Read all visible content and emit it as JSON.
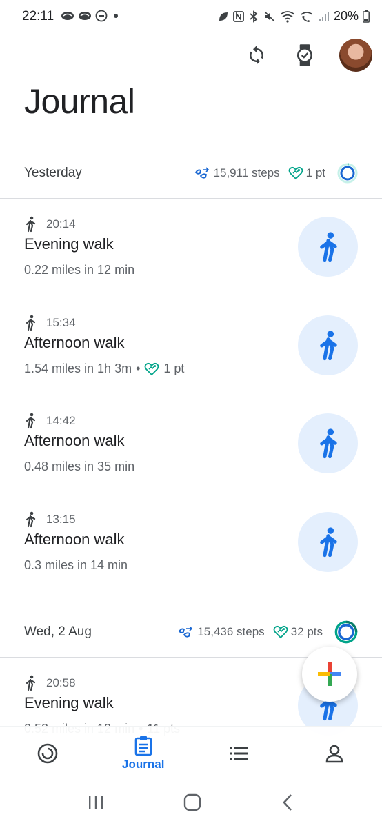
{
  "status_bar": {
    "time": "22:11",
    "battery": "20%"
  },
  "header": {
    "title": "Journal"
  },
  "days": [
    {
      "label": "Yesterday",
      "steps": "15,911 steps",
      "heart_points": "1 pt",
      "activities": [
        {
          "time": "20:14",
          "title": "Evening walk",
          "detail": "0.22 miles in 12 min",
          "points": ""
        },
        {
          "time": "15:34",
          "title": "Afternoon walk",
          "detail": "1.54 miles in 1h 3m",
          "points": "1 pt"
        },
        {
          "time": "14:42",
          "title": "Afternoon walk",
          "detail": "0.48 miles in 35 min",
          "points": ""
        },
        {
          "time": "13:15",
          "title": "Afternoon walk",
          "detail": "0.3 miles in 14 min",
          "points": ""
        }
      ]
    },
    {
      "label": "Wed, 2 Aug",
      "steps": "15,436 steps",
      "heart_points": "32 pts",
      "activities": [
        {
          "time": "20:58",
          "title": "Evening walk",
          "detail": "0.52 miles in 12 min",
          "points": "11 pts"
        }
      ]
    }
  ],
  "bottom_nav": {
    "journal_label": "Journal"
  },
  "colors": {
    "accent": "#1a73e8",
    "heart": "#00a389",
    "steps": "#1967d2",
    "badge_bg": "#e4effd"
  }
}
